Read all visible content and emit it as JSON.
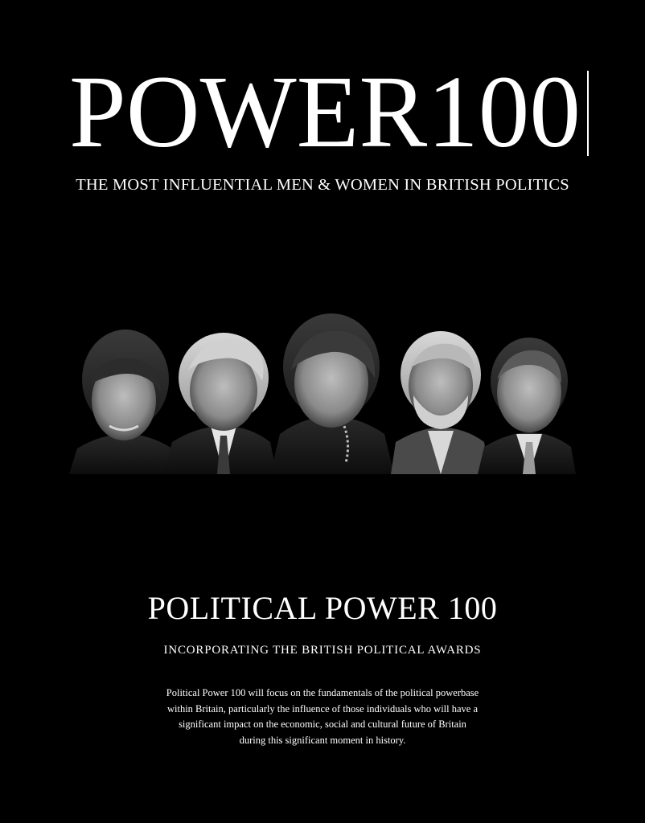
{
  "masthead": {
    "title": "POWER100"
  },
  "tagline": "THE MOST INFLUENTIAL MEN & WOMEN IN BRITISH POLITICS",
  "section": {
    "title": "POLITICAL POWER 100",
    "subtitle": "INCORPORATING THE BRITISH POLITICAL AWARDS",
    "body_lines": [
      "Political Power 100 will focus on the fundamentals of the political powerbase",
      "within Britain, particularly the influence of those individuals who will have a",
      "significant impact on the economic, social and cultural future of Britain",
      "during this significant moment in history."
    ]
  },
  "colors": {
    "background": "#000000",
    "text": "#ffffff"
  }
}
